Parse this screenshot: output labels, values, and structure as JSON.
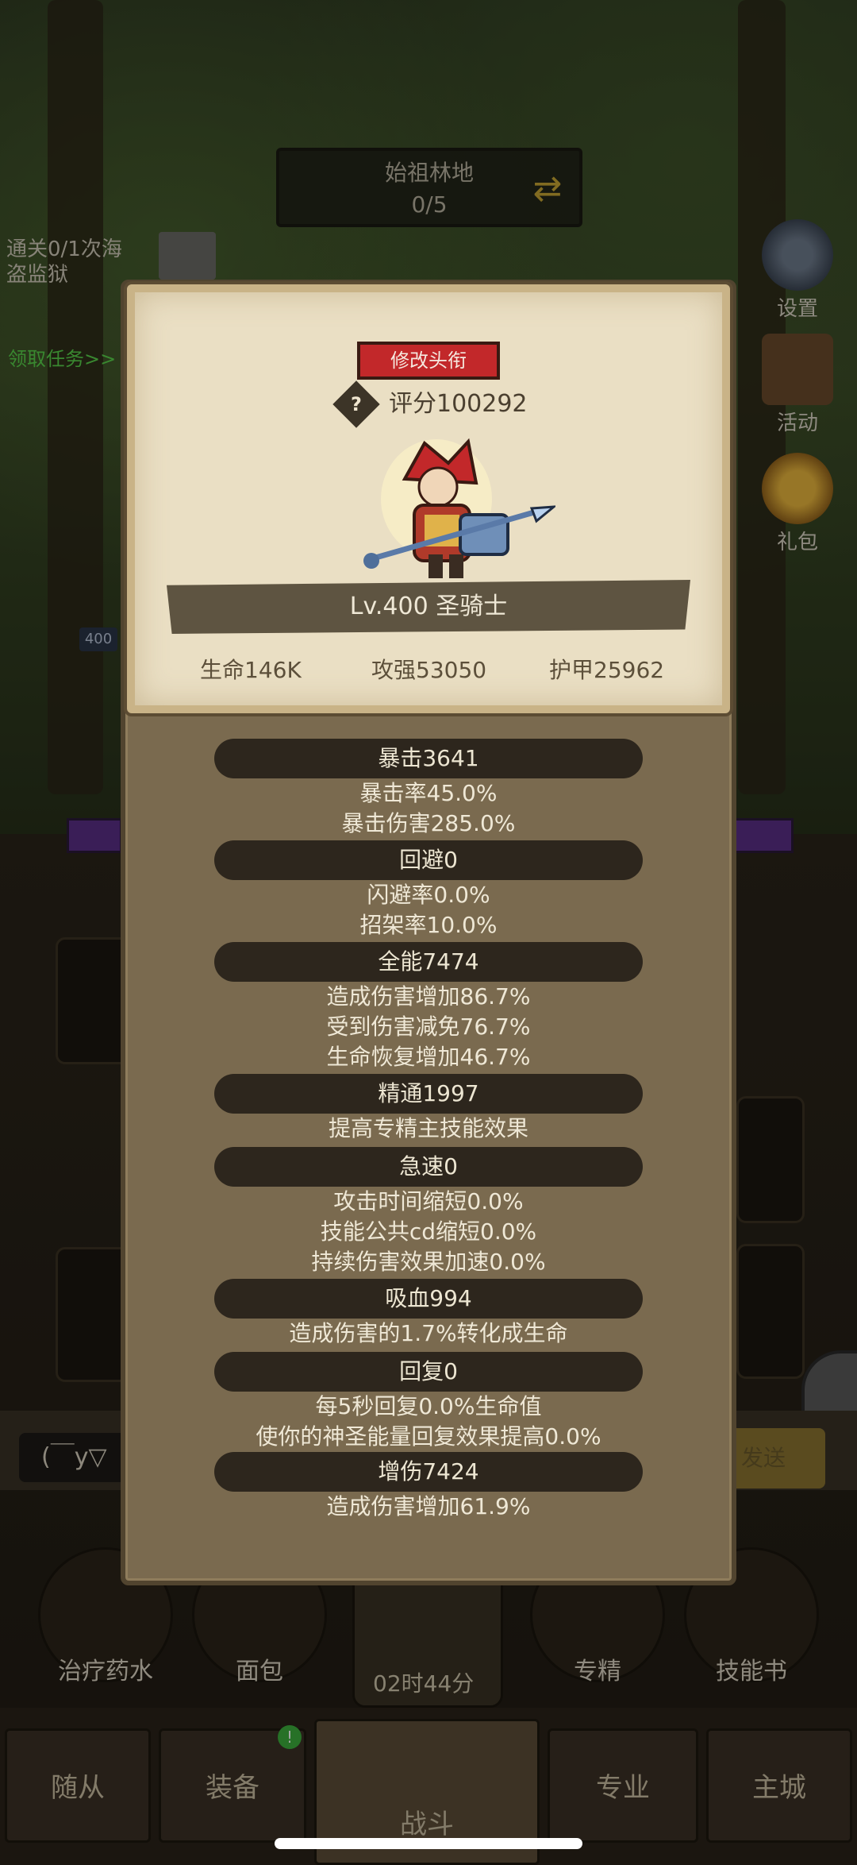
{
  "background": {
    "location_name": "始祖林地",
    "location_progress": "0/5",
    "quest_text": "通关0/1次海盗监狱",
    "quest_link": "领取任务>>",
    "side_buttons": [
      {
        "label": "设置",
        "icon": "gear-icon"
      },
      {
        "label": "活动",
        "icon": "scroll-icon"
      },
      {
        "label": "礼包",
        "icon": "gift-icon"
      }
    ],
    "level_badge": "400",
    "chat_input": "(￣y▽",
    "chat_send": "发送",
    "consumables": [
      {
        "label": "治疗药水",
        "icon": "potion-icon"
      },
      {
        "label": "面包",
        "icon": "bread-icon"
      },
      {
        "label": "",
        "icon": "chest-icon"
      },
      {
        "label": "专精",
        "icon": "specialization-icon"
      },
      {
        "label": "技能书",
        "icon": "skillbook-icon"
      }
    ],
    "timer": "02时44分",
    "nav_tabs": [
      {
        "label": "随从"
      },
      {
        "label": "装备",
        "badge": "!"
      },
      {
        "label": "战斗",
        "active": true
      },
      {
        "label": "专业"
      },
      {
        "label": "主城"
      }
    ]
  },
  "panel": {
    "title_button": "修改头衔",
    "score": "评分100292",
    "help_glyph": "?",
    "hero_name": "Lv.400 圣骑士",
    "core_stats": [
      "生命146K",
      "攻强53050",
      "护甲25962"
    ],
    "sections": [
      {
        "header": "暴击3641",
        "lines": [
          "暴击率45.0%",
          "暴击伤害285.0%"
        ]
      },
      {
        "header": "回避0",
        "lines": [
          "闪避率0.0%",
          "招架率10.0%"
        ]
      },
      {
        "header": "全能7474",
        "lines": [
          "造成伤害增加86.7%",
          "受到伤害减免76.7%",
          "生命恢复增加46.7%"
        ]
      },
      {
        "header": "精通1997",
        "lines": [
          "提高专精主技能效果"
        ]
      },
      {
        "header": "急速0",
        "lines": [
          "攻击时间缩短0.0%",
          "技能公共cd缩短0.0%",
          "持续伤害效果加速0.0%"
        ]
      },
      {
        "header": "吸血994",
        "lines": [
          "造成伤害的1.7%转化成生命"
        ]
      },
      {
        "header": "回复0",
        "lines": [
          "每5秒回复0.0%生命值",
          "使你的神圣能量回复效果提高0.0%"
        ]
      },
      {
        "header": "增伤7424",
        "lines": [
          "造成伤害增加61.9%"
        ]
      }
    ]
  }
}
